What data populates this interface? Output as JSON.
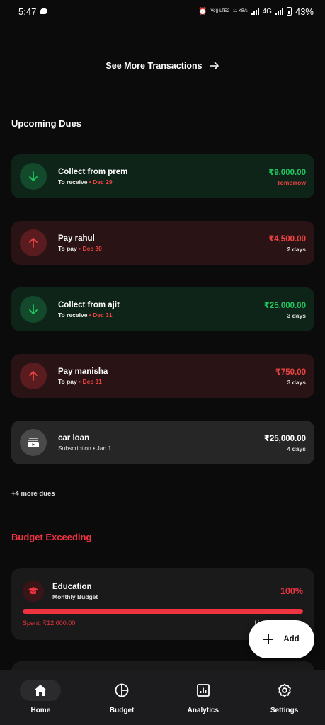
{
  "status_bar": {
    "time": "5:47",
    "network_volte": "Vo)) LTE2",
    "speed": "11 KB/s",
    "network_type": "4G",
    "battery": "43%"
  },
  "see_more": {
    "label": "See More Transactions",
    "icon": "arrow-right-icon"
  },
  "upcoming": {
    "title": "Upcoming Dues",
    "items": [
      {
        "kind": "receive",
        "icon": "arrow-down-icon",
        "title": "Collect from prem",
        "label": "To receive",
        "date": "Dec 29",
        "amount": "₹9,000.00",
        "when": "Tomorrow"
      },
      {
        "kind": "pay",
        "icon": "arrow-up-icon",
        "title": "Pay rahul",
        "label": "To pay",
        "date": "Dec 30",
        "amount": "₹4,500.00",
        "when": "2 days"
      },
      {
        "kind": "receive",
        "icon": "arrow-down-icon",
        "title": "Collect from ajit",
        "label": "To receive",
        "date": "Dec 31",
        "amount": "₹25,000.00",
        "when": "3 days"
      },
      {
        "kind": "pay",
        "icon": "arrow-up-icon",
        "title": "Pay manisha",
        "label": "To pay",
        "date": "Dec 31",
        "amount": "₹750.00",
        "when": "3 days"
      },
      {
        "kind": "sub",
        "icon": "subscription-icon",
        "title": "car loan",
        "label": "Subscription",
        "date": "Jan 1",
        "amount": "₹25,000.00",
        "when": "4 days"
      }
    ],
    "more": "+4 more dues"
  },
  "budget": {
    "title": "Budget Exceeding",
    "card": {
      "icon": "graduation-cap-icon",
      "name": "Education",
      "type": "Monthly Budget",
      "percent": "100%",
      "progress_fraction": 1.0,
      "spent": "Spent: ₹12,000.00",
      "limit": "Lim"
    }
  },
  "fab": {
    "label": "Add",
    "icon": "plus-icon"
  },
  "nav": {
    "items": [
      {
        "label": "Home",
        "icon": "home-icon"
      },
      {
        "label": "Budget",
        "icon": "pie-chart-icon"
      },
      {
        "label": "Analytics",
        "icon": "analytics-icon"
      },
      {
        "label": "Settings",
        "icon": "gear-icon"
      }
    ]
  },
  "colors": {
    "receive": "#22c55e",
    "pay": "#ef4444",
    "accent_red": "#ef3340",
    "background": "#0b0b0b"
  }
}
